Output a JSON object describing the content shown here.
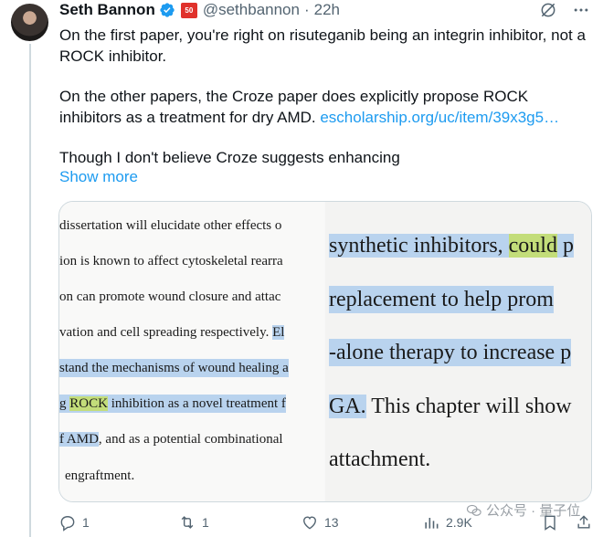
{
  "author": {
    "name": "Seth Bannon",
    "handle": "@sethbannon",
    "separator": "·",
    "time": "22h",
    "badge_text": "50"
  },
  "tweet": {
    "paragraph1": "On the first paper, you're right on risuteganib being an integrin inhibitor, not a ROCK inhibitor.",
    "paragraph2_text": "On the other papers, the Croze paper does explicitly propose ROCK inhibitors as a treatment for dry AMD.",
    "paragraph2_link": "escholarship.org/uc/item/39x3g5…",
    "paragraph3": "Though I don't believe Croze suggests enhancing",
    "show_more": "Show more"
  },
  "media": {
    "left_lines": [
      [
        "dissertation will elucidate other effects o",
        ""
      ],
      [
        "ion is known to affect cytoskeletal rearra",
        ""
      ],
      [
        "on can promote wound closure and attac",
        ""
      ],
      [
        "vation and cell spreading respectively. ",
        "El"
      ],
      [
        "stand the mechanisms of wound healing a",
        ""
      ],
      [
        "g ",
        "ROCK",
        " inhibition as a novel treatment f"
      ],
      [
        "f AMD",
        ", and as a potential combinational"
      ],
      [
        "engraftment.",
        ""
      ]
    ],
    "right_lines": [
      [
        "synthetic inhibitors, ",
        "could",
        " p"
      ],
      [
        "replacement to help prom"
      ],
      [
        "-alone therapy to increase p"
      ],
      [
        "GA.",
        " This chapter will show"
      ],
      [
        "attachment."
      ]
    ]
  },
  "actions": {
    "replies": "1",
    "reposts": "1",
    "likes": "13",
    "views": "2.9K"
  },
  "watermark": "公众号 · 量子位",
  "colors": {
    "link": "#1d9bf0",
    "muted": "#536471",
    "highlight_blue": "#b9d3ee",
    "highlight_green": "#c3dd7a",
    "verified": "#1d9bf0"
  }
}
